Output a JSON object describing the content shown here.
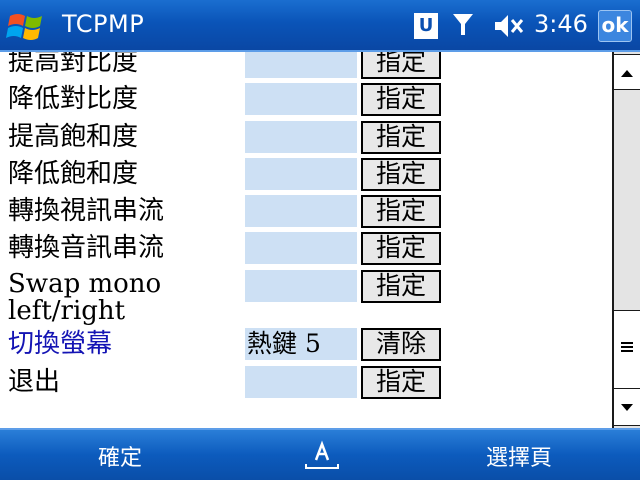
{
  "titlebar": {
    "app_title": "TCPMP",
    "status_u": "U",
    "clock": "3:46",
    "ok_label": "ok"
  },
  "hotkeys": [
    {
      "label": "提高對比度",
      "value": "",
      "button": "指定"
    },
    {
      "label": "降低對比度",
      "value": "",
      "button": "指定"
    },
    {
      "label": "提高飽和度",
      "value": "",
      "button": "指定"
    },
    {
      "label": "降低飽和度",
      "value": "",
      "button": "指定"
    },
    {
      "label": "轉換視訊串流",
      "value": "",
      "button": "指定"
    },
    {
      "label": "轉換音訊串流",
      "value": "",
      "button": "指定"
    },
    {
      "label": "Swap mono left/right",
      "value": "",
      "button": "指定"
    },
    {
      "label": "切換螢幕",
      "value": "熱鍵 5",
      "button": "清除"
    },
    {
      "label": "退出",
      "value": "",
      "button": "指定"
    }
  ],
  "menubar": {
    "left_softkey": "確定",
    "right_softkey": "選擇頁"
  },
  "colors": {
    "titlebar": "#0a54b8",
    "field_bg": "#cde0f4",
    "highlight_label": "#1414b4"
  }
}
